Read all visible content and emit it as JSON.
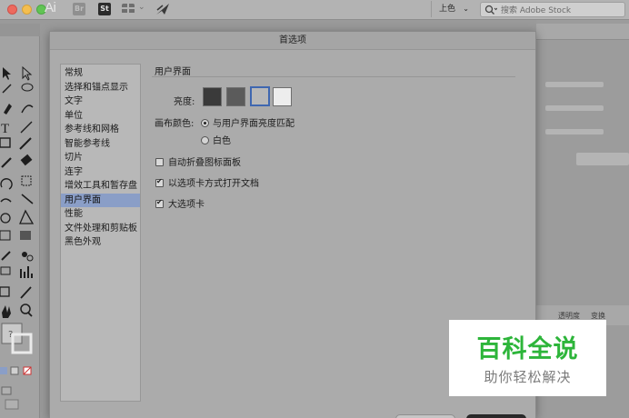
{
  "app_bar": {
    "logo": "Ai",
    "bridge_label": "Br",
    "stock_label": "St",
    "workspace_label": "上色",
    "search_placeholder": "搜索 Adobe Stock"
  },
  "dialog": {
    "title": "首选项",
    "categories": [
      "常规",
      "选择和锚点显示",
      "文字",
      "单位",
      "参考线和网格",
      "智能参考线",
      "切片",
      "连字",
      "增效工具和暂存盘",
      "用户界面",
      "性能",
      "文件处理和剪贴板",
      "黑色外观"
    ],
    "selected_category": "用户界面",
    "section_title": "用户界面",
    "brightness_label": "亮度:",
    "brightness_selected_index": 2,
    "canvas_color_label": "画布颜色:",
    "canvas_options": [
      "与用户界面亮度匹配",
      "白色"
    ],
    "canvas_selected_index": 0,
    "checkboxes": [
      {
        "label": "自动折叠图标面板",
        "checked": false
      },
      {
        "label": "以选项卡方式打开文档",
        "checked": true
      },
      {
        "label": "大选项卡",
        "checked": true
      }
    ]
  },
  "right_panel": {
    "tab_1": "透明度",
    "tab_2": "变换"
  },
  "watermark": {
    "title": "百科全说",
    "subtitle": "助你轻松解决"
  },
  "colors": {
    "selected_swatch_border": "#3f67b0",
    "selected_category_bg": "#8a9ec7",
    "watermark_green": "#2db53a"
  }
}
